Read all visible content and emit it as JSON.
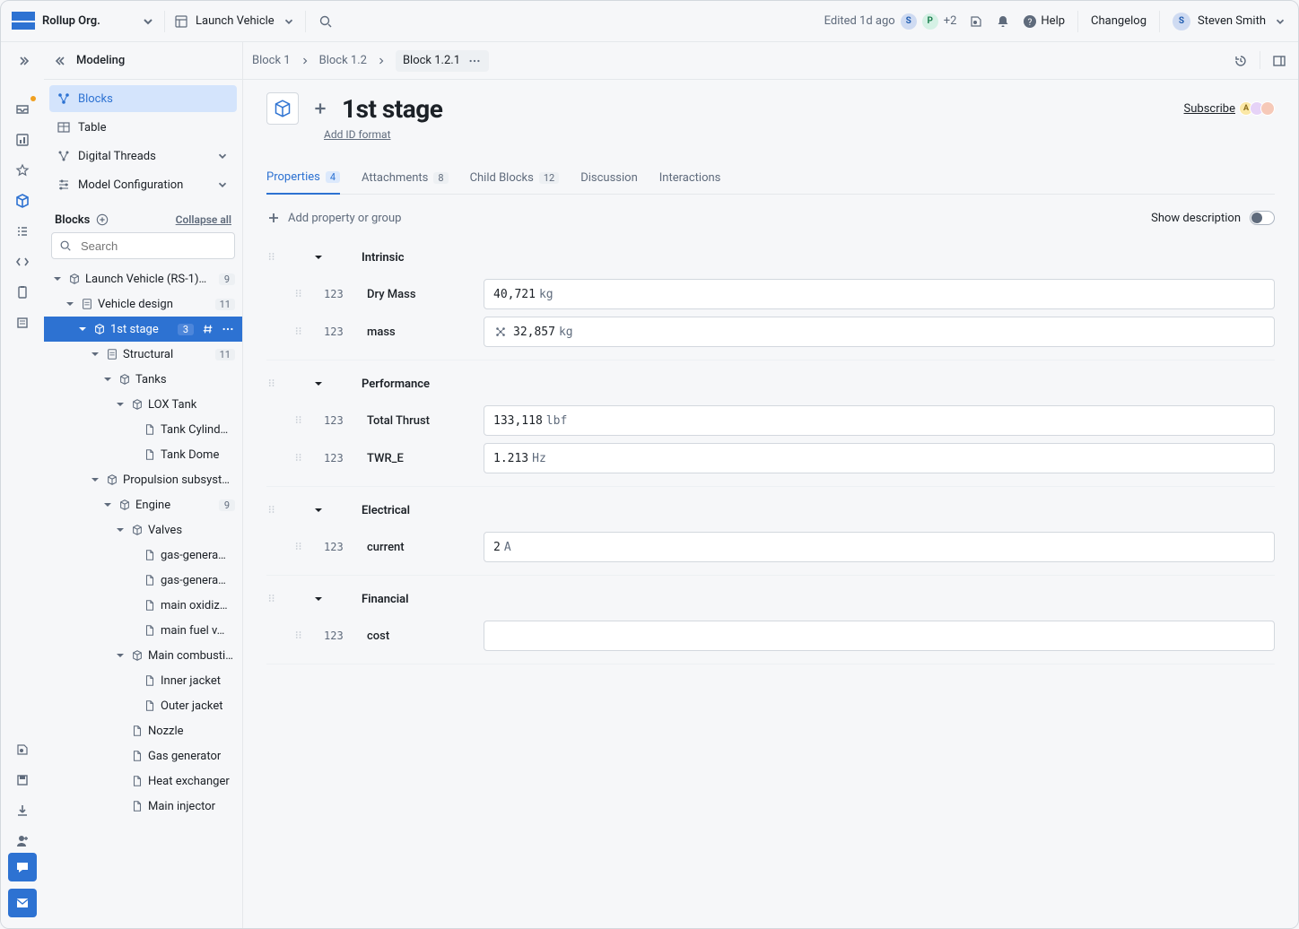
{
  "header": {
    "org": "Rollup Org.",
    "project": "Launch Vehicle",
    "edited": "Edited 1d ago",
    "editors_more": "+2",
    "help": "Help",
    "changelog": "Changelog",
    "user": "Steven Smith",
    "avatars": {
      "s": "S",
      "p": "P"
    }
  },
  "sidepanel": {
    "title": "Modeling",
    "items": [
      "Blocks",
      "Table",
      "Digital Threads",
      "Model Configuration"
    ],
    "blocks_label": "Blocks",
    "collapse_all": "Collapse all",
    "search_placeholder": "Search"
  },
  "tree": [
    {
      "depth": 0,
      "tri": true,
      "iconType": "cube",
      "label": "Launch Vehicle (RS-1)…",
      "badge": "9",
      "sel": false
    },
    {
      "depth": 1,
      "tri": true,
      "iconType": "file",
      "label": "Vehicle design",
      "badge": "11",
      "sel": false
    },
    {
      "depth": 2,
      "tri": true,
      "iconType": "cube",
      "label": "1st stage",
      "badge": "3",
      "sel": true
    },
    {
      "depth": 3,
      "tri": true,
      "iconType": "file",
      "label": "Structural",
      "badge": "11",
      "sel": false
    },
    {
      "depth": 4,
      "tri": true,
      "iconType": "cube",
      "label": "Tanks",
      "badge": "",
      "sel": false
    },
    {
      "depth": 5,
      "tri": true,
      "iconType": "cube",
      "label": "LOX Tank",
      "badge": "",
      "sel": false
    },
    {
      "depth": 6,
      "tri": false,
      "iconType": "file2",
      "label": "Tank Cylind…",
      "badge": "",
      "sel": false
    },
    {
      "depth": 6,
      "tri": false,
      "iconType": "file2",
      "label": "Tank Dome",
      "badge": "",
      "sel": false
    },
    {
      "depth": 3,
      "tri": true,
      "iconType": "cube",
      "label": "Propulsion subsyst…",
      "badge": "",
      "sel": false
    },
    {
      "depth": 4,
      "tri": true,
      "iconType": "cube",
      "label": "Engine",
      "badge": "9",
      "sel": false
    },
    {
      "depth": 5,
      "tri": true,
      "iconType": "cube",
      "label": "Valves",
      "badge": "",
      "sel": false
    },
    {
      "depth": 6,
      "tri": false,
      "iconType": "file2",
      "label": "gas-genera…",
      "badge": "",
      "sel": false
    },
    {
      "depth": 6,
      "tri": false,
      "iconType": "file2",
      "label": "gas-genera…",
      "badge": "",
      "sel": false
    },
    {
      "depth": 6,
      "tri": false,
      "iconType": "file2",
      "label": "main oxidiz…",
      "badge": "",
      "sel": false
    },
    {
      "depth": 6,
      "tri": false,
      "iconType": "file2",
      "label": "main fuel v…",
      "badge": "",
      "sel": false
    },
    {
      "depth": 5,
      "tri": true,
      "iconType": "cube",
      "label": "Main combusti…",
      "badge": "",
      "sel": false
    },
    {
      "depth": 6,
      "tri": false,
      "iconType": "file2",
      "label": "Inner jacket",
      "badge": "",
      "sel": false
    },
    {
      "depth": 6,
      "tri": false,
      "iconType": "file2",
      "label": "Outer jacket",
      "badge": "",
      "sel": false
    },
    {
      "depth": 5,
      "tri": false,
      "iconType": "file2",
      "label": "Nozzle",
      "badge": "",
      "sel": false
    },
    {
      "depth": 5,
      "tri": false,
      "iconType": "file2",
      "label": "Gas generator",
      "badge": "",
      "sel": false
    },
    {
      "depth": 5,
      "tri": false,
      "iconType": "file2",
      "label": "Heat exchanger",
      "badge": "",
      "sel": false
    },
    {
      "depth": 5,
      "tri": false,
      "iconType": "file2",
      "label": "Main injector",
      "badge": "",
      "sel": false
    }
  ],
  "breadcrumbs": {
    "a": "Block 1",
    "b": "Block 1.2",
    "c": "Block 1.2.1"
  },
  "page": {
    "title": "1st stage",
    "add_id": "Add ID format",
    "subscribe": "Subscribe"
  },
  "tabs": {
    "properties": {
      "label": "Properties",
      "count": "4"
    },
    "attachments": {
      "label": "Attachments",
      "count": "8"
    },
    "child": {
      "label": "Child Blocks",
      "count": "12"
    },
    "discussion": {
      "label": "Discussion"
    },
    "interactions": {
      "label": "Interactions"
    }
  },
  "toolbar": {
    "add": "Add property or group",
    "showdesc": "Show description"
  },
  "groups": [
    {
      "name": "Intrinsic",
      "props": [
        {
          "name": "Dry Mass",
          "value": "40,721",
          "unit": "kg",
          "formula": false
        },
        {
          "name": "mass",
          "value": "32,857",
          "unit": "kg",
          "formula": true
        }
      ]
    },
    {
      "name": "Performance",
      "props": [
        {
          "name": "Total Thrust",
          "value": "133,118",
          "unit": "lbf",
          "formula": false
        },
        {
          "name": "TWR_E",
          "value": "1.213",
          "unit": "Hz",
          "formula": false
        }
      ]
    },
    {
      "name": "Electrical",
      "props": [
        {
          "name": "current",
          "value": "2",
          "unit": "A",
          "formula": false
        }
      ]
    },
    {
      "name": "Financial",
      "props": [
        {
          "name": "cost",
          "value": "",
          "unit": "",
          "formula": false
        }
      ]
    }
  ]
}
